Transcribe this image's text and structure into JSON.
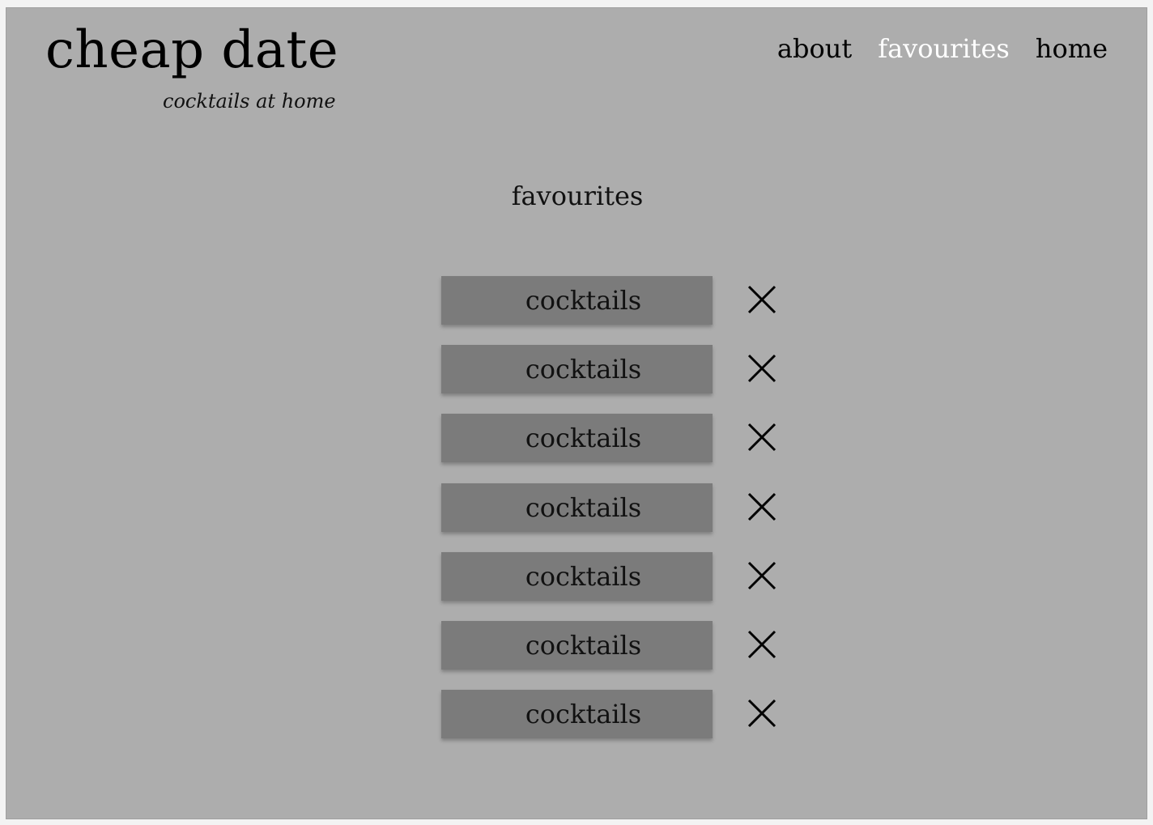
{
  "brand": {
    "title": "cheap date",
    "subtitle": "cocktails at home"
  },
  "nav": {
    "items": [
      {
        "label": "about",
        "active": false
      },
      {
        "label": "favourites",
        "active": true
      },
      {
        "label": "home",
        "active": false
      }
    ]
  },
  "main": {
    "title": "favourites",
    "favourites": [
      {
        "label": "cocktails"
      },
      {
        "label": "cocktails"
      },
      {
        "label": "cocktails"
      },
      {
        "label": "cocktails"
      },
      {
        "label": "cocktails"
      },
      {
        "label": "cocktails"
      },
      {
        "label": "cocktails"
      }
    ]
  },
  "icons": {
    "remove": "close-icon"
  },
  "colors": {
    "background": "#adadad",
    "button": "#7b7b7b",
    "active_nav": "#ffffff",
    "text": "#000000"
  }
}
